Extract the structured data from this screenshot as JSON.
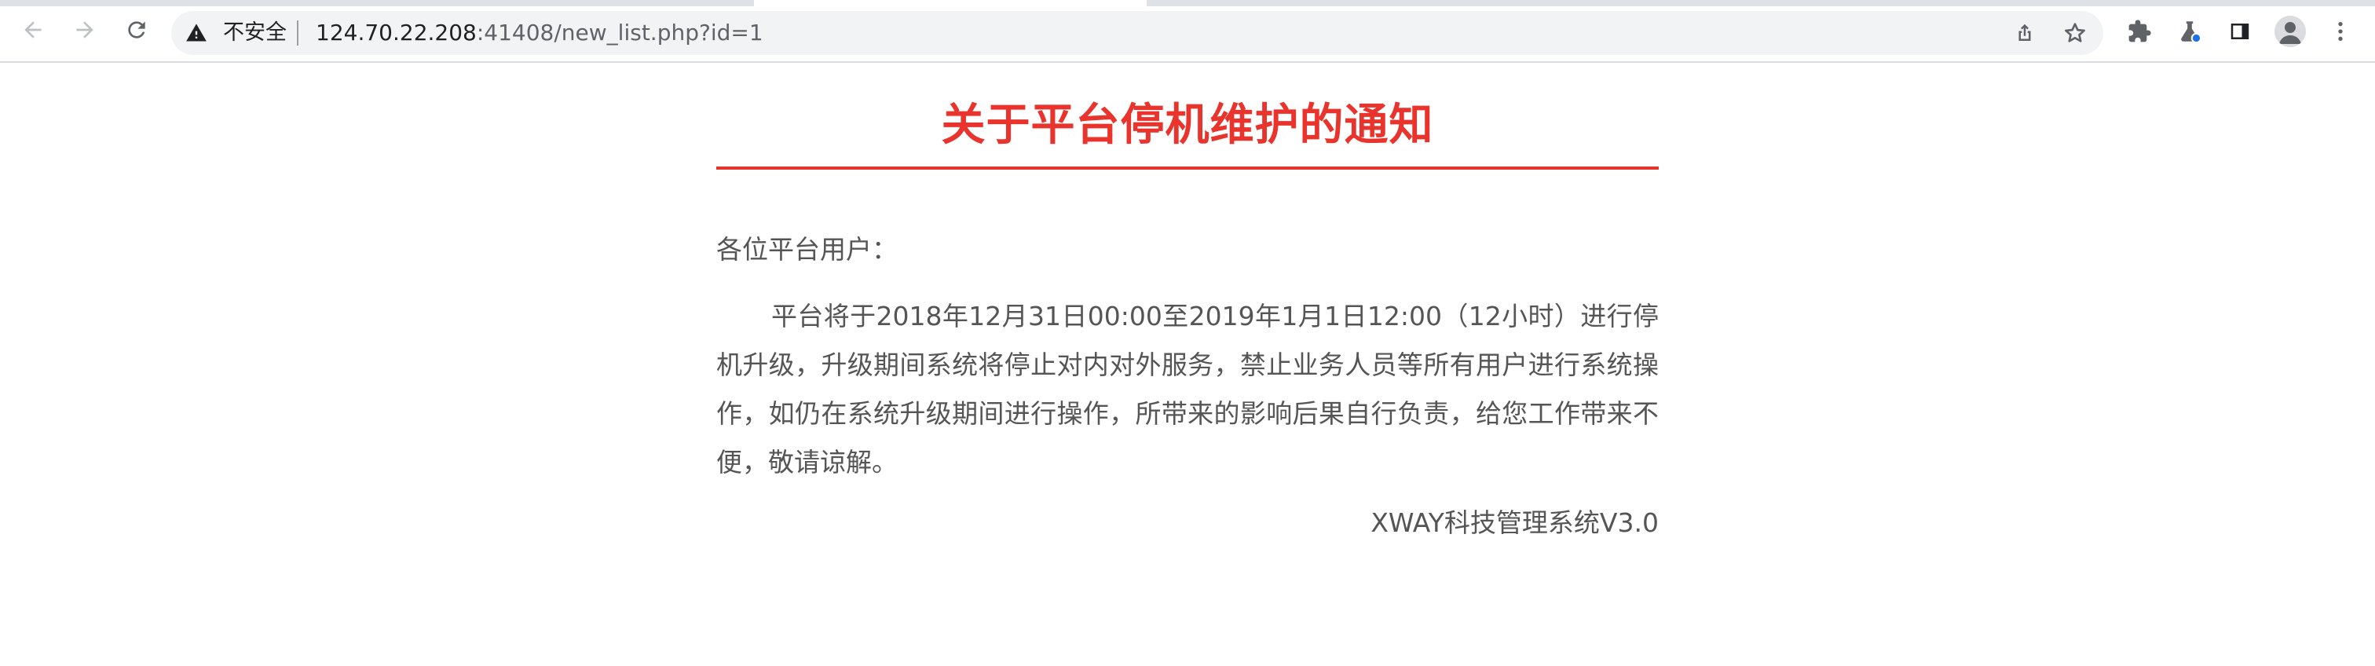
{
  "browser": {
    "security_label": "不安全",
    "url_host": "124.70.22.208",
    "url_rest": ":41408/new_list.php?id=1"
  },
  "notice": {
    "title": "关于平台停机维护的通知",
    "greeting": "各位平台用户：",
    "body": "平台将于2018年12月31日00:00至2019年1月1日12:00（12小时）进行停机升级，升级期间系统将停止对内对外服务，禁止业务人员等所有用户进行系统操作，如仍在系统升级期间进行操作，所带来的影响后果自行负责，给您工作带来不便，敬请谅解。",
    "signature": "XWAY科技管理系统V3.0"
  },
  "colors": {
    "accent": "#e8342c",
    "body_text": "#555555"
  }
}
